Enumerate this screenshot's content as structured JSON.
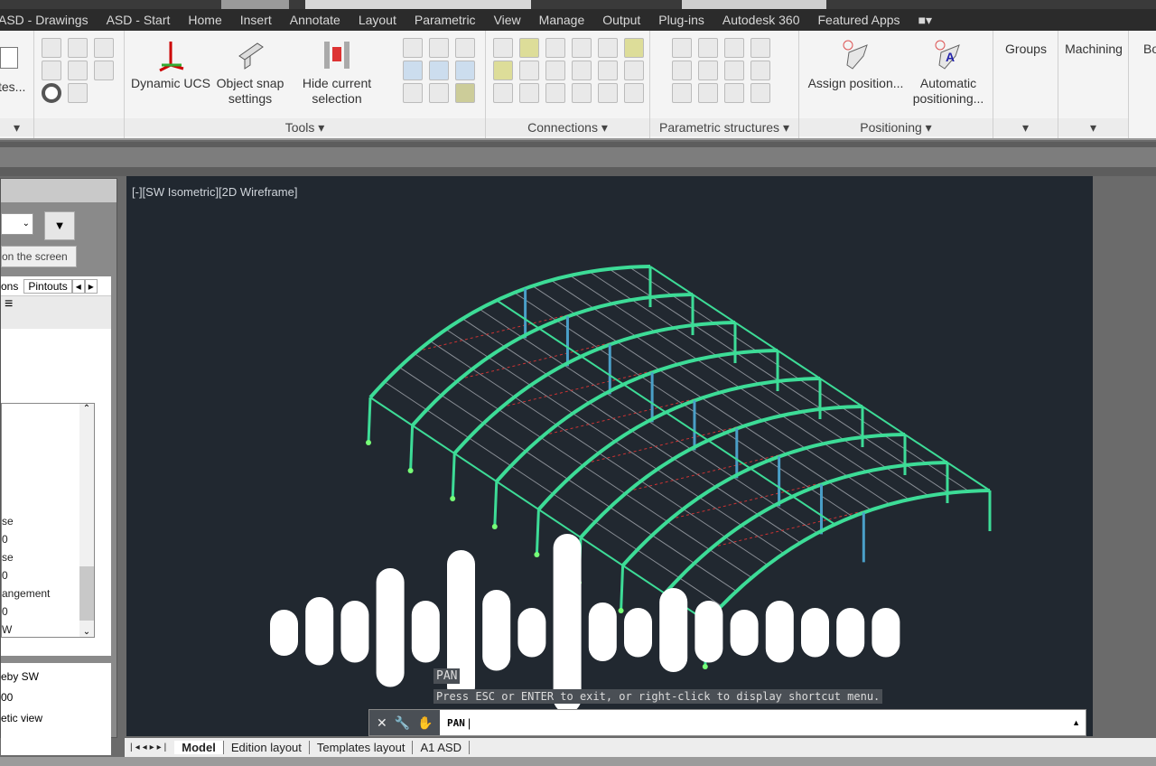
{
  "menu_tabs": [
    "ASD - Drawings",
    "ASD - Start",
    "Home",
    "Insert",
    "Annotate",
    "Layout",
    "Parametric",
    "View",
    "Manage",
    "Output",
    "Plug-ins",
    "Autodesk 360",
    "Featured Apps"
  ],
  "ribbon": {
    "left_partial_label": "tes...",
    "tools": {
      "dynamic_ucs": "Dynamic UCS",
      "object_snap": "Object snap settings",
      "hide_selection": "Hide current selection",
      "label": "Tools"
    },
    "connections": {
      "label": "Connections"
    },
    "parametric": {
      "label": "Parametric structures"
    },
    "positioning": {
      "assign": "Assign position...",
      "automatic": "Automatic positioning...",
      "label": "Positioning"
    },
    "groups": "Groups",
    "machining": "Machining",
    "partial": "Bo"
  },
  "palette": {
    "tooltip": "on the screen",
    "tabs": [
      "ons",
      "Pintouts"
    ],
    "list_items": [
      "se",
      "0",
      "se",
      "0",
      "angement",
      "0",
      "W"
    ],
    "info": [
      "eby SW",
      "00",
      "etic view"
    ]
  },
  "viewport": {
    "label": "[-][SW Isometric][2D Wireframe]",
    "history": [
      "PAN",
      "Press ESC or ENTER to exit, or right-click to display shortcut menu."
    ],
    "background": "#212830",
    "frame_color": "#3ddc97"
  },
  "command": {
    "value": "PAN"
  },
  "layout_tabs": [
    "Model",
    "Edition layout",
    "Templates layout",
    "A1 ASD"
  ]
}
